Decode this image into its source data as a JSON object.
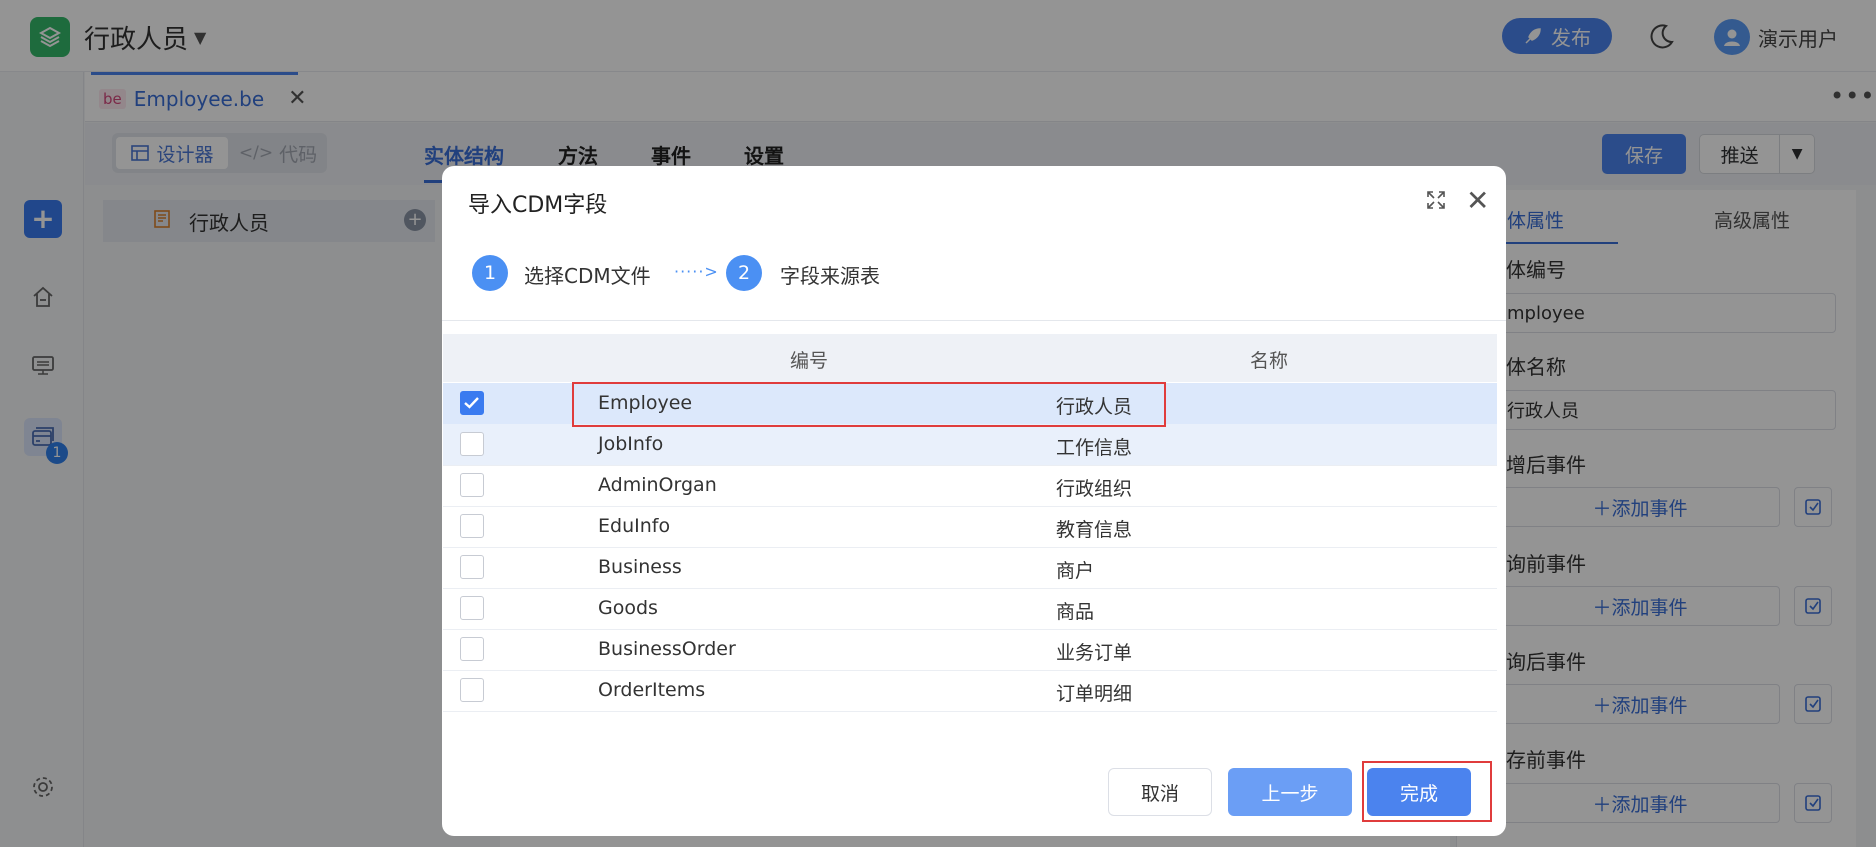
{
  "app": {
    "title": "行政人员",
    "publish_label": "发布",
    "user_name": "演示用户"
  },
  "file_tab": {
    "badge": "be",
    "name": "Employee.be"
  },
  "toolbar": {
    "designer_label": "设计器",
    "code_label": "代码",
    "tabs": [
      "实体结构",
      "方法",
      "事件",
      "设置"
    ],
    "save_label": "保存",
    "push_label": "推送"
  },
  "rail": {
    "badge_count": "1"
  },
  "tree": {
    "root_label": "行政人员"
  },
  "right_panel": {
    "tabs": [
      "实体属性",
      "高级属性"
    ],
    "fields": [
      {
        "label": "体编号",
        "value": "mployee"
      },
      {
        "label": "体名称",
        "value": "行政人员"
      }
    ],
    "events": [
      {
        "label": "增后事件",
        "add_label": "添加事件"
      },
      {
        "label": "询前事件",
        "add_label": "添加事件"
      },
      {
        "label": "询后事件",
        "add_label": "添加事件"
      },
      {
        "label": "存前事件",
        "add_label": "添加事件"
      }
    ]
  },
  "dialog": {
    "title": "导入CDM字段",
    "steps": [
      {
        "num": "1",
        "label": "选择CDM文件"
      },
      {
        "num": "2",
        "label": "字段来源表"
      }
    ],
    "step_arrow": "·····>",
    "columns": {
      "code": "编号",
      "name": "名称"
    },
    "rows": [
      {
        "code": "Employee",
        "name": "行政人员",
        "checked": true
      },
      {
        "code": "JobInfo",
        "name": "工作信息",
        "checked": false
      },
      {
        "code": "AdminOrgan",
        "name": "行政组织",
        "checked": false
      },
      {
        "code": "EduInfo",
        "name": "教育信息",
        "checked": false
      },
      {
        "code": "Business",
        "name": "商户",
        "checked": false
      },
      {
        "code": "Goods",
        "name": "商品",
        "checked": false
      },
      {
        "code": "BusinessOrder",
        "name": "业务订单",
        "checked": false
      },
      {
        "code": "OrderItems",
        "name": "订单明细",
        "checked": false
      }
    ],
    "buttons": {
      "cancel": "取消",
      "prev": "上一步",
      "finish": "完成"
    }
  }
}
